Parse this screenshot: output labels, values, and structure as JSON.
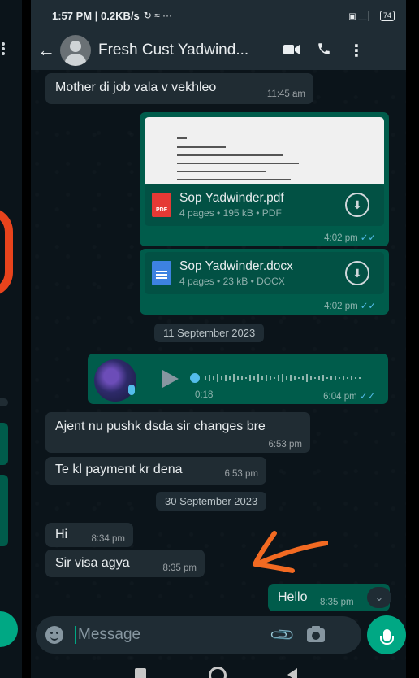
{
  "status_bar": {
    "time": "1:57 PM | 0.2KB/s",
    "icons": "↻ ≈ ···",
    "right_icons": "▣ ⸏││",
    "battery": "74"
  },
  "header": {
    "contact_name": "Fresh Cust Yadwind...",
    "back_icon": "arrow-left-icon",
    "video_icon": "video-camera-icon",
    "call_icon": "phone-icon",
    "menu_icon": "more-vertical-icon"
  },
  "messages": {
    "m1": {
      "text": "Mother di job vala v vekhleo",
      "time": "11:45 am"
    },
    "doc1": {
      "name": "Sop Yadwinder.pdf",
      "details": "4 pages • 195 kB • PDF",
      "icon_label": "PDF"
    },
    "doc2": {
      "name": "Sop Yadwinder.docx",
      "details": "4 pages • 23 kB • DOCX",
      "time": "4:02 pm"
    },
    "doc_group_time": "4:02 pm",
    "date1": "11 September 2023",
    "voice": {
      "duration": "0:18",
      "time": "6:04 pm"
    },
    "m3": {
      "text": "Ajent nu pushk dsda sir changes bre",
      "time": "6:53 pm"
    },
    "m4": {
      "text": "Te kl payment kr dena",
      "time": "6:53 pm"
    },
    "date2": "30 September 2023",
    "m5": {
      "text": "Hi",
      "time": "8:34 pm"
    },
    "m6": {
      "text": "Sir visa agya",
      "time": "8:35 pm"
    },
    "m7": {
      "text": "Hello",
      "time": "8:35 pm"
    }
  },
  "read_ticks": "✓✓",
  "composer": {
    "placeholder": "Message",
    "attach_icon": "paperclip-icon",
    "camera_icon": "camera-icon",
    "mic_icon": "microphone-icon",
    "emoji_icon": "emoji-icon"
  },
  "colors": {
    "background": "#0b141a",
    "incoming": "#202c33",
    "outgoing": "#005c4b",
    "accent": "#00a884",
    "read_ticks": "#53bdeb",
    "annotation": "#f26a22"
  }
}
